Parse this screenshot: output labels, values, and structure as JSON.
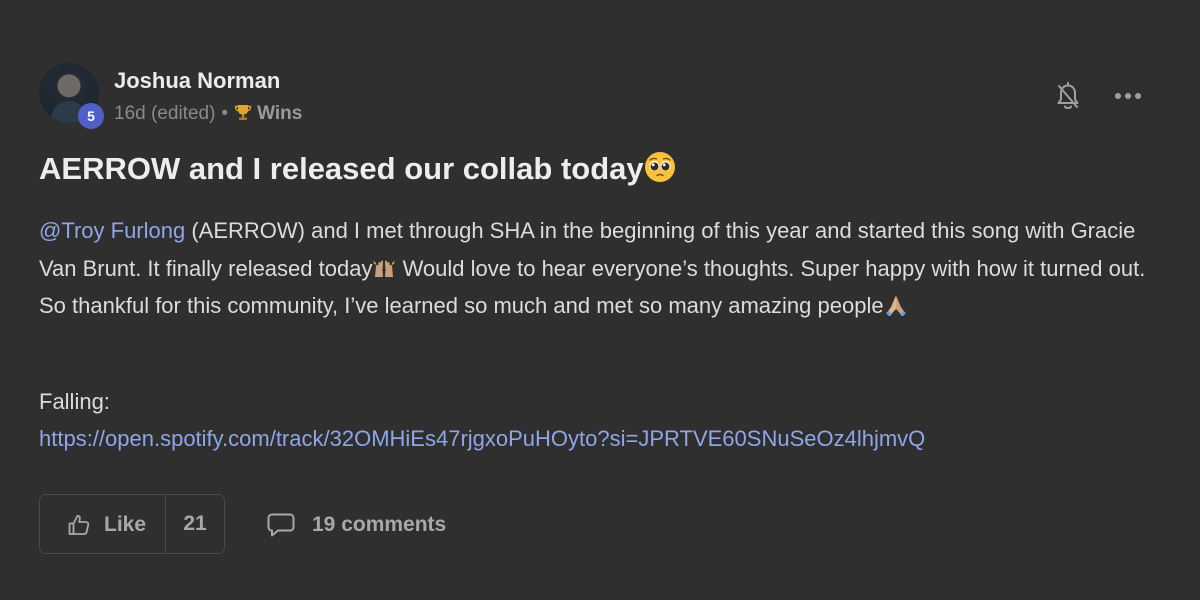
{
  "author": {
    "name": "Joshua Norman",
    "level": "5",
    "time": "16d (edited)",
    "separator": "•",
    "category": "Wins"
  },
  "post": {
    "title": "AERROW and I released our collab today",
    "mention": "@Troy Furlong",
    "body_part1": " (AERROW) and I met through SHA in the beginning of this year and started this song with Gracie Van Brunt. It finally released today",
    "body_part2": " Would love to hear everyone’s thoughts. Super happy with how it turned out. So thankful for this community, I’ve learned so much and met so many amazing people",
    "falling_label": "Falling:",
    "link": "https://open.spotify.com/track/32OMHiEs47rjgxoPuHOyto?si=JPRTVE60SNuSeOz4lhjmvQ"
  },
  "actions": {
    "like_label": "Like",
    "like_count": "21",
    "comments_label": "19 comments"
  },
  "icons": {
    "bell": "bell-off-icon",
    "more": "more-horizontal-icon",
    "trophy": "trophy-icon",
    "like": "thumbs-up-icon",
    "comment": "comment-bubble-icon",
    "emoji_title": "pleading-face-emoji",
    "emoji_raised_hands": "raised-hands-emoji",
    "emoji_folded_hands": "folded-hands-emoji"
  },
  "colors": {
    "background": "#2f2f2f",
    "link": "#8ea6e8",
    "level_badge": "#5160c9",
    "text": "#dcdcdc",
    "muted": "#8a8a8a"
  }
}
